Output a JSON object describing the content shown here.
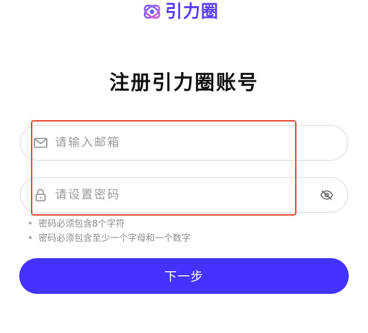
{
  "brand": {
    "name": "引力圈",
    "logo_icon": "orbit-logo-icon",
    "color": "#5b3df5"
  },
  "title": "注册引力圈账号",
  "email_field": {
    "placeholder": "请输入邮箱",
    "value": "",
    "icon": "mail-icon"
  },
  "password_field": {
    "placeholder": "请设置密码",
    "value": "",
    "icon": "lock-icon",
    "toggle_icon": "eye-off-icon"
  },
  "password_rules": [
    "密码必须包含8个字符",
    "密码必须包含至少一个字母和一个数字"
  ],
  "next_button": {
    "label": "下一步",
    "color": "#4433ff"
  },
  "annotation": {
    "highlight_color": "#e8442e"
  }
}
